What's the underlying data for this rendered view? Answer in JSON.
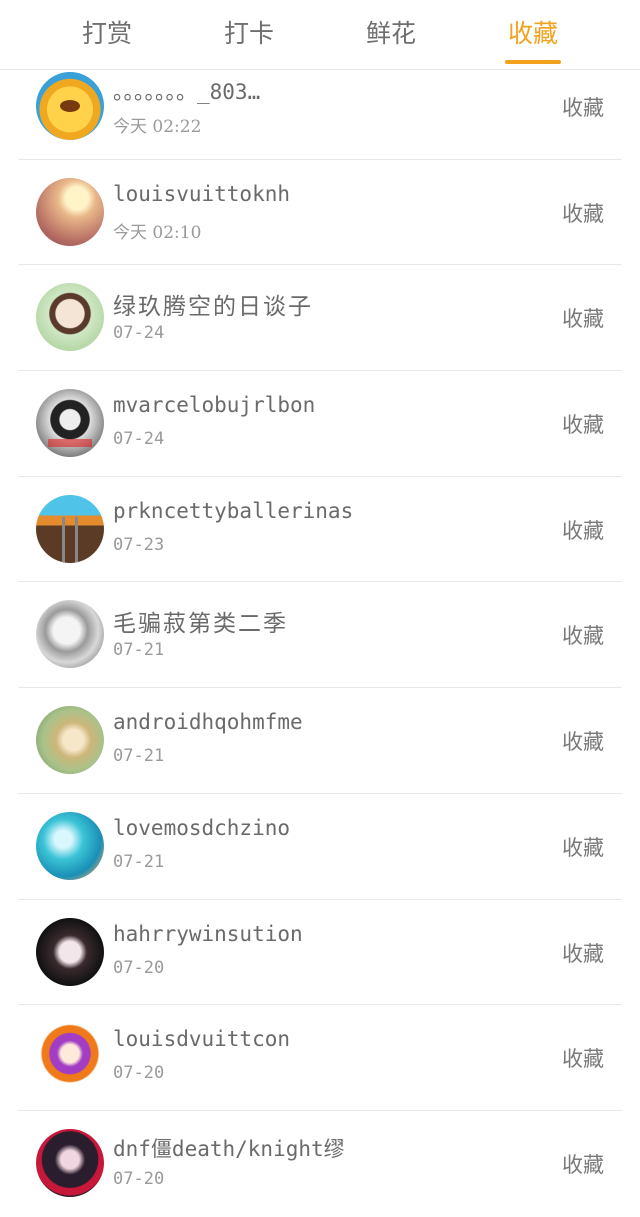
{
  "tabs": [
    {
      "label": "打赏",
      "active": false
    },
    {
      "label": "打卡",
      "active": false
    },
    {
      "label": "鲜花",
      "active": false
    },
    {
      "label": "收藏",
      "active": true
    }
  ],
  "colors": {
    "accent": "#f3a21d",
    "text": "#6a6a6a",
    "subtext": "#9a9a9a",
    "divider": "#e8e8e8"
  },
  "items": [
    {
      "name": "。。。。。。。_803…",
      "date": "今天 02:22",
      "action": "收藏",
      "avatar": "cartoon-bear-avatar"
    },
    {
      "name": "louisvuittoknh",
      "date": "今天 02:10",
      "action": "收藏",
      "avatar": "sunlight-photo-avatar"
    },
    {
      "name": "绿玖腾空的日谈子",
      "date": "07-24",
      "action": "收藏",
      "avatar": "girl-photo-avatar"
    },
    {
      "name": "mvarcelobujrlbon",
      "date": "07-24",
      "action": "收藏",
      "avatar": "sunglasses-photo-avatar"
    },
    {
      "name": "prkncettyballerinas",
      "date": "07-23",
      "action": "收藏",
      "avatar": "railway-photo-avatar"
    },
    {
      "name": "毛骗菽第类二季",
      "date": "07-21",
      "action": "收藏",
      "avatar": "grayscale-photo-avatar"
    },
    {
      "name": "androidhqohmfme",
      "date": "07-21",
      "action": "收藏",
      "avatar": "blonde-photo-avatar"
    },
    {
      "name": "lovemosdchzino",
      "date": "07-21",
      "action": "收藏",
      "avatar": "sea-photo-avatar"
    },
    {
      "name": "hahrrywinsution",
      "date": "07-20",
      "action": "收藏",
      "avatar": "dark-portrait-avatar"
    },
    {
      "name": "louisdvuittcon",
      "date": "07-20",
      "action": "收藏",
      "avatar": "anime-character-avatar"
    },
    {
      "name": "dnf僵death/knight缪",
      "date": "07-20",
      "action": "收藏",
      "avatar": "couple-photo-avatar"
    }
  ]
}
